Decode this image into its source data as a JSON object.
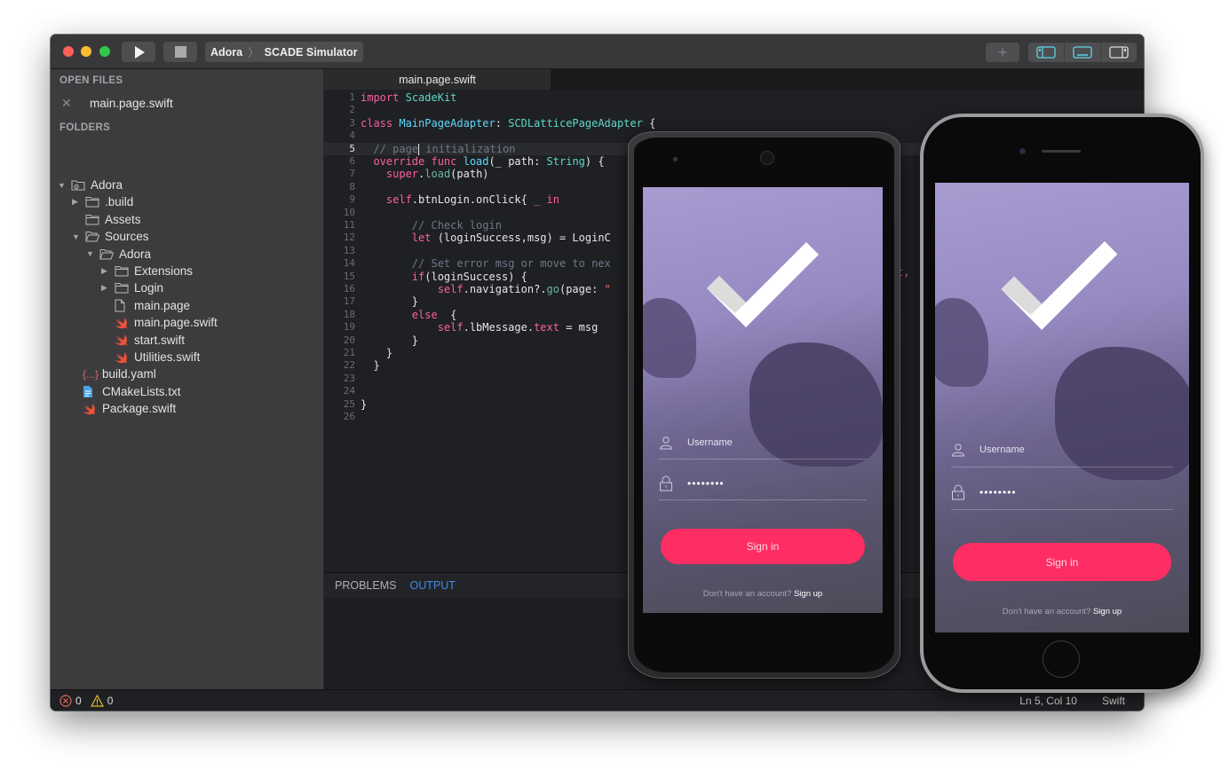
{
  "window": {
    "breadcrumb": [
      "Adora",
      "SCADE Simulator"
    ],
    "breadcrumb_sep": "〉",
    "plus_label": "+"
  },
  "sidebar": {
    "open_files_title": "OPEN FILES",
    "open_files": [
      {
        "name": "main.page.swift",
        "close": "✕"
      }
    ],
    "folders_title": "FOLDERS",
    "tree": [
      {
        "label": "Adora",
        "depth": 0,
        "arrow": "▼",
        "icon": "project-folder-icon"
      },
      {
        "label": ".build",
        "depth": 1,
        "arrow": "▶",
        "icon": "folder-icon"
      },
      {
        "label": "Assets",
        "depth": 1,
        "arrow": "",
        "icon": "folder-icon"
      },
      {
        "label": "Sources",
        "depth": 1,
        "arrow": "▼",
        "icon": "folder-open-icon"
      },
      {
        "label": "Adora",
        "depth": 2,
        "arrow": "▼",
        "icon": "folder-open-icon"
      },
      {
        "label": "Extensions",
        "depth": 3,
        "arrow": "▶",
        "icon": "folder-icon"
      },
      {
        "label": "Login",
        "depth": 3,
        "arrow": "▶",
        "icon": "folder-icon"
      },
      {
        "label": "main.page",
        "depth": 3,
        "arrow": "",
        "icon": "file-icon"
      },
      {
        "label": "main.page.swift",
        "depth": 3,
        "arrow": "",
        "icon": "swift-icon"
      },
      {
        "label": "start.swift",
        "depth": 3,
        "arrow": "",
        "icon": "swift-icon"
      },
      {
        "label": "Utilities.swift",
        "depth": 3,
        "arrow": "",
        "icon": "swift-icon"
      },
      {
        "label": "build.yaml",
        "depth": 1,
        "arrow": "",
        "icon": "yaml-icon"
      },
      {
        "label": "CMakeLists.txt",
        "depth": 1,
        "arrow": "",
        "icon": "text-file-icon"
      },
      {
        "label": "Package.swift",
        "depth": 1,
        "arrow": "",
        "icon": "swift-icon"
      }
    ]
  },
  "editor": {
    "tab": "main.page.swift",
    "current_line": 5,
    "lines": [
      [
        [
          "kw",
          "import"
        ],
        [
          "",
          " "
        ],
        [
          "ty",
          "ScadeKit"
        ]
      ],
      [],
      [
        [
          "kw",
          "class"
        ],
        [
          "",
          " "
        ],
        [
          "cl",
          "MainPageAdapter"
        ],
        [
          "",
          ": "
        ],
        [
          "ty",
          "SCDLatticePageAdapter"
        ],
        [
          "",
          " {"
        ]
      ],
      [],
      [
        [
          "cm",
          "  // page"
        ],
        [
          "caret",
          ""
        ],
        [
          "cm",
          " initialization"
        ]
      ],
      [
        [
          "kw",
          "  override func"
        ],
        [
          "",
          " "
        ],
        [
          "cl",
          "load"
        ],
        [
          "",
          "(_ path: "
        ],
        [
          "ty",
          "String"
        ],
        [
          "",
          ") {"
        ]
      ],
      [
        [
          "kw",
          "    super"
        ],
        [
          "",
          "."
        ],
        [
          "fn",
          "load"
        ],
        [
          "",
          "(path)"
        ]
      ],
      [],
      [
        [
          "kw",
          "    self"
        ],
        [
          "",
          ".btnLogin.onClick{ "
        ],
        [
          "kw",
          "_ in"
        ]
      ],
      [],
      [
        [
          "cm",
          "        // Check login"
        ]
      ],
      [
        [
          "kw",
          "        let"
        ],
        [
          "",
          " (loginSuccess,msg) = LoginC"
        ]
      ],
      [],
      [
        [
          "cm",
          "        // Set error msg or move to nex"
        ]
      ],
      [
        [
          "kw",
          "        if"
        ],
        [
          "",
          "(loginSuccess) {"
        ]
      ],
      [
        [
          "kw",
          "            self"
        ],
        [
          "",
          ".navigation?."
        ],
        [
          "fn",
          "go"
        ],
        [
          "",
          "(page: "
        ],
        [
          "str",
          "\""
        ]
      ],
      [
        [
          "",
          "        }"
        ]
      ],
      [
        [
          "kw",
          "        else"
        ],
        [
          "",
          "  {"
        ]
      ],
      [
        [
          "kw",
          "            self"
        ],
        [
          "",
          ".lbMessage."
        ],
        [
          "kw",
          "text"
        ],
        [
          "",
          " = msg"
        ]
      ],
      [
        [
          "",
          "        }"
        ]
      ],
      [
        [
          "",
          "    }"
        ]
      ],
      [
        [
          "",
          "  }"
        ]
      ],
      [],
      [],
      [
        [
          "",
          "}"
        ]
      ],
      []
    ],
    "overflow_fragment": "t,"
  },
  "panel": {
    "tabs": [
      {
        "label": "PROBLEMS",
        "active": false
      },
      {
        "label": "OUTPUT",
        "active": true
      }
    ]
  },
  "status": {
    "errors": "0",
    "warnings": "0",
    "position": "Ln 5, Col 10",
    "language": "Swift"
  },
  "simulator": {
    "username_placeholder": "Username",
    "password_value": "••••••••",
    "sign_in": "Sign in",
    "no_account": "Don't have an account?",
    "sign_up": "Sign up",
    "accent": "#fe2d64"
  }
}
